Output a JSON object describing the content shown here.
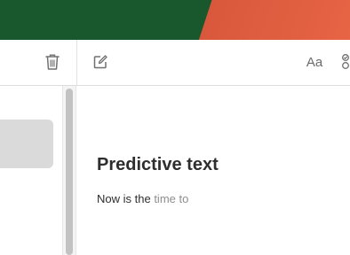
{
  "toolbar": {
    "delete_icon": "trash-icon",
    "compose_icon": "compose-icon",
    "format_label": "Aa",
    "checklist_icon": "checklist-icon"
  },
  "note": {
    "title": "Predictive text",
    "body_typed": "Now is the ",
    "body_suggestion": "time to"
  },
  "colors": {
    "wallpaper_green": "#19572c",
    "wallpaper_orange": "#e8644a",
    "selected_item": "#dadada",
    "suggestion_text": "#8e8e8e"
  }
}
